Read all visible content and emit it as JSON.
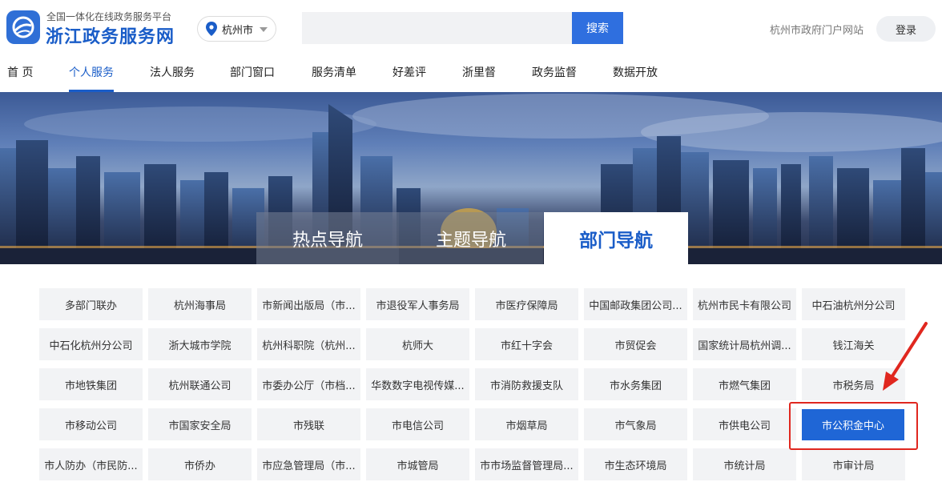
{
  "header": {
    "logo_sub": "全国一体化在线政务服务平台",
    "logo_main": "浙江政务服务网",
    "city": "杭州市",
    "search_placeholder": "",
    "search_button": "搜索",
    "portal_link": "杭州市政府门户网站",
    "login": "登录"
  },
  "nav": {
    "items": [
      "首 页",
      "个人服务",
      "法人服务",
      "部门窗口",
      "服务清单",
      "好差评",
      "浙里督",
      "政务监督",
      "数据开放"
    ],
    "active": "个人服务"
  },
  "banner_tabs": {
    "hot": "热点导航",
    "theme": "主题导航",
    "dept": "部门导航"
  },
  "departments": [
    [
      "多部门联办",
      "杭州海事局",
      "市新闻出版局（市...",
      "市退役军人事务局",
      "市医疗保障局",
      "中国邮政集团公司...",
      "杭州市民卡有限公司",
      "中石油杭州分公司"
    ],
    [
      "中石化杭州分公司",
      "浙大城市学院",
      "杭州科职院（杭州...",
      "杭师大",
      "市红十字会",
      "市贸促会",
      "国家统计局杭州调...",
      "钱江海关"
    ],
    [
      "市地铁集团",
      "杭州联通公司",
      "市委办公厅（市档...",
      "华数数字电视传媒...",
      "市消防救援支队",
      "市水务集团",
      "市燃气集团",
      "市税务局"
    ],
    [
      "市移动公司",
      "市国家安全局",
      "市残联",
      "市电信公司",
      "市烟草局",
      "市气象局",
      "市供电公司",
      "市公积金中心"
    ],
    [
      "市人防办（市民防...",
      "市侨办",
      "市应急管理局（市...",
      "市城管局",
      "市市场监督管理局...",
      "市生态环境局",
      "市统计局",
      "市审计局"
    ]
  ],
  "highlighted_department": "市公积金中心",
  "colors": {
    "brand_blue": "#1a5dc8",
    "highlight_blue": "#1f66d6",
    "annotation_red": "#e0271f"
  }
}
